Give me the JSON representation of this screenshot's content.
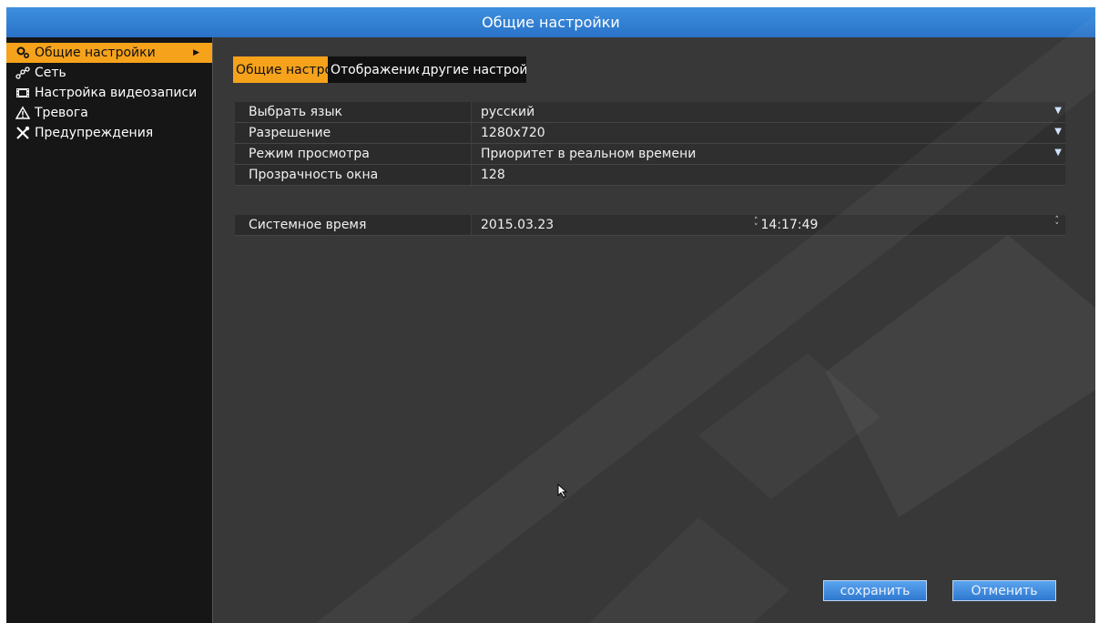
{
  "window": {
    "title": "Общие настройки"
  },
  "sidebar": {
    "items": [
      {
        "label": "Общие настройки",
        "icon": "gears-icon",
        "active": true
      },
      {
        "label": "Сеть",
        "icon": "network-icon",
        "active": false
      },
      {
        "label": "Настройка видеозаписи",
        "icon": "film-icon",
        "active": false
      },
      {
        "label": "Тревога",
        "icon": "warning-icon",
        "active": false
      },
      {
        "label": "Предупреждения",
        "icon": "tools-icon",
        "active": false
      }
    ]
  },
  "tabs": [
    {
      "label": "Общие настройки",
      "active": true
    },
    {
      "label": "Отображение",
      "active": false
    },
    {
      "label": "другие  настройки",
      "active": false
    }
  ],
  "settings": [
    {
      "label": "Выбрать язык",
      "value": "русский",
      "dropdown": true
    },
    {
      "label": "Разрешение",
      "value": "1280x720",
      "dropdown": true
    },
    {
      "label": "Режим просмотра",
      "value": "Приоритет в реальном времени",
      "dropdown": true
    },
    {
      "label": "Прозрачность окна",
      "value": "128",
      "dropdown": false
    }
  ],
  "system_time": {
    "label": "Системное время",
    "date": "2015.03.23",
    "time": "14:17:49"
  },
  "buttons": {
    "save": "сохранить",
    "cancel": "Отменить"
  },
  "colors": {
    "accent": "#f6a21b",
    "title_bar": "#2f7fd5",
    "button": "#3f8ae0"
  }
}
